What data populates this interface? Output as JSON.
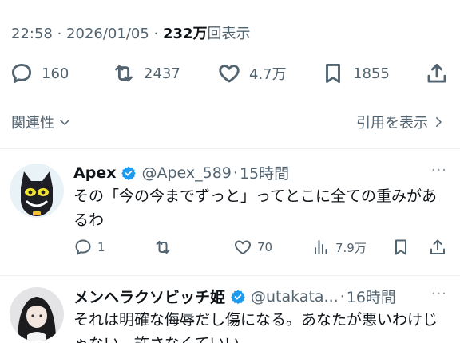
{
  "tweet": {
    "time": "22:58",
    "sep1": " · ",
    "date": "2026/01/05",
    "sep2": " · ",
    "views_count": "232万",
    "views_suffix": "回表示",
    "stats": {
      "replies": "160",
      "retweets": "2437",
      "likes": "4.7万",
      "bookmarks": "1855"
    }
  },
  "sort": {
    "label": "関連性",
    "quotes_link": "引用を表示"
  },
  "replies": [
    {
      "name": "Apex",
      "handle": "@Apex_589",
      "sep": "·",
      "time": "15時間",
      "more": "···",
      "text": "その「今の今までずっと」ってとこに全ての重みがあるわ",
      "stats": {
        "replies": "1",
        "retweets": "",
        "likes": "70",
        "views": "7.9万"
      }
    },
    {
      "name": "メンヘラクソビッチ姫",
      "handle": "@utakata...",
      "sep": "·",
      "time": "16時間",
      "more": "···",
      "text": "それは明確な侮辱だし傷になる。あなたが悪いわけじゃない、許さなくていい。"
    }
  ],
  "colors": {
    "muted": "#536471",
    "verified_blue": "#1d9bf0",
    "divider": "#eff3f4"
  },
  "icons": [
    "reply-icon",
    "retweet-icon",
    "like-icon",
    "bookmark-icon",
    "share-icon",
    "views-icon",
    "verified-badge-icon",
    "chevron-down-icon",
    "chevron-right-icon"
  ]
}
